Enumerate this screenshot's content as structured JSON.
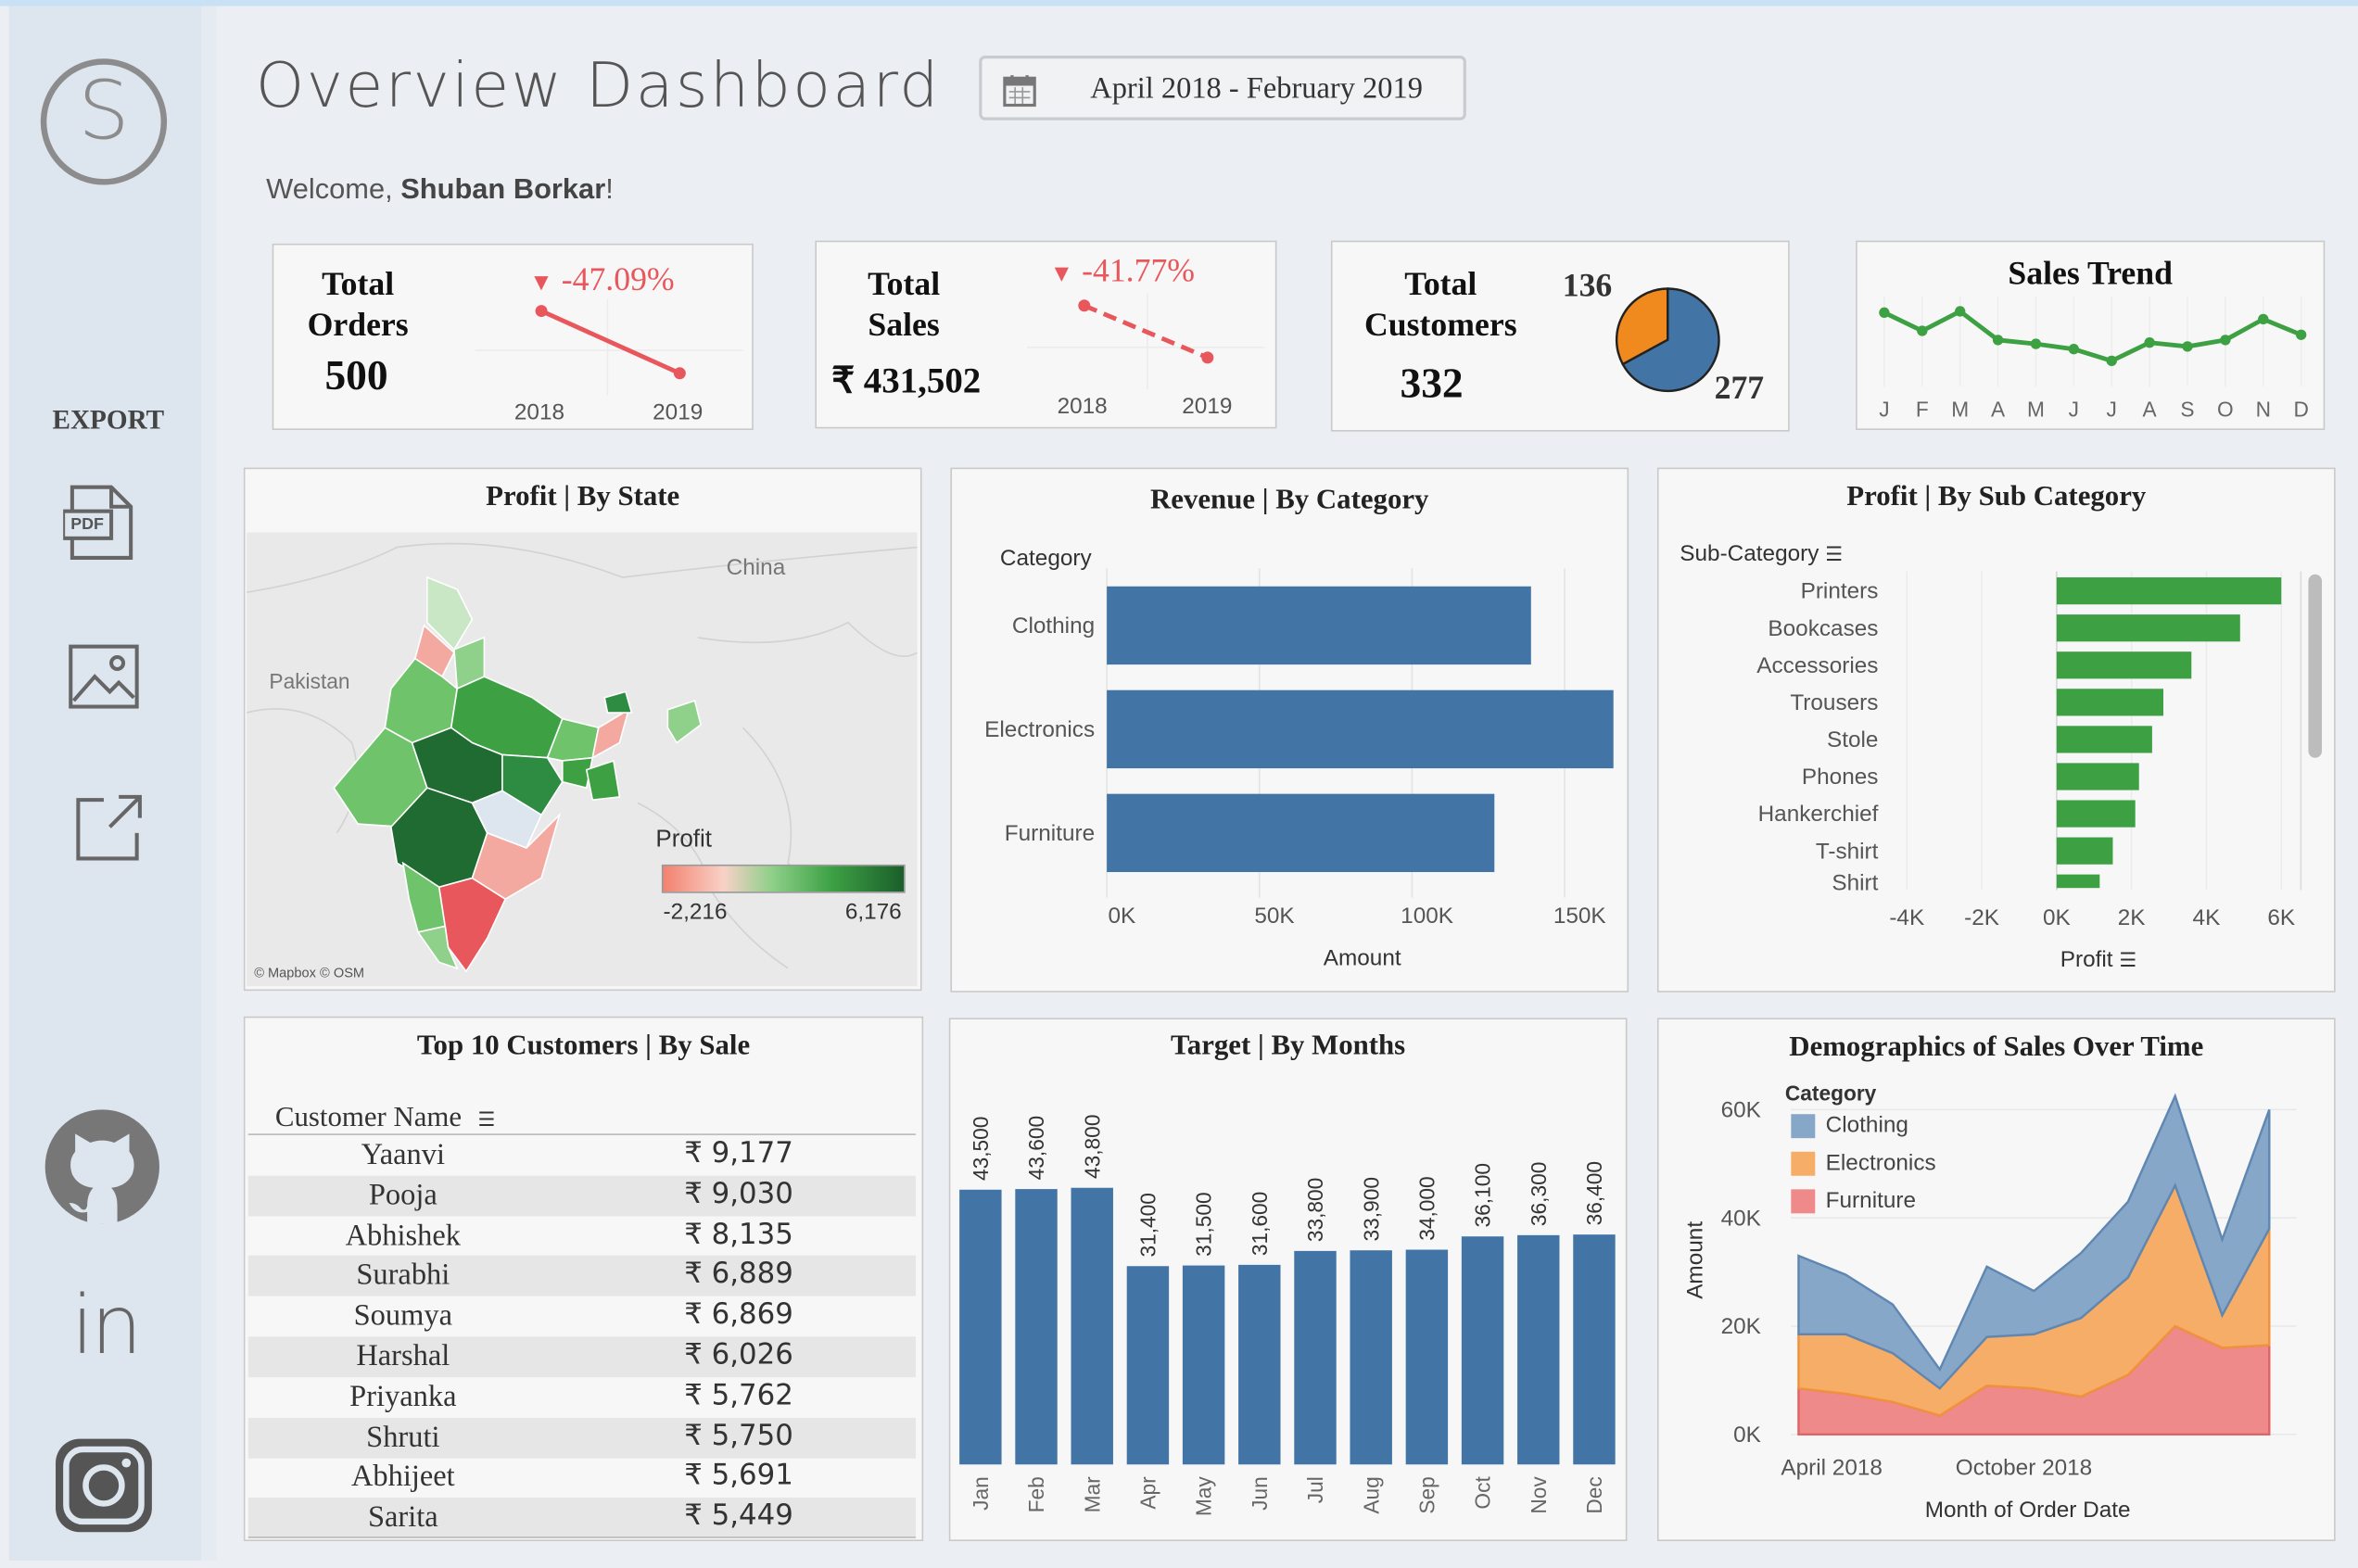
{
  "header": {
    "title": "Overview Dashboard",
    "date_range": "April 2018 - February 2019",
    "welcome_prefix": "Welcome, ",
    "user_name": "Shuban Borkar",
    "welcome_suffix": "!"
  },
  "sidebar": {
    "logo_letter": "S",
    "export_label": "EXPORT",
    "pdf_label": "PDF",
    "export_icons": [
      "pdf-icon",
      "image-icon",
      "share-icon"
    ],
    "social_icons": [
      "github-icon",
      "linkedin-icon",
      "instagram-icon"
    ],
    "linkedin_text": "in"
  },
  "kpis": {
    "orders": {
      "title_line1": "Total",
      "title_line2": "Orders",
      "value": "500",
      "delta": "-47.09%",
      "years": [
        "2018",
        "2019"
      ]
    },
    "sales": {
      "title_line1": "Total",
      "title_line2": "Sales",
      "value": "₹ 431,502",
      "delta": "-41.77%",
      "years": [
        "2018",
        "2019"
      ]
    },
    "customers": {
      "title_line1": "Total",
      "title_line2": "Customers",
      "value": "332",
      "pie_label_a": "136",
      "pie_label_b": "277"
    },
    "sales_trend": {
      "title": "Sales Trend",
      "months": [
        "J",
        "F",
        "M",
        "A",
        "M",
        "J",
        "J",
        "A",
        "S",
        "O",
        "N",
        "D"
      ]
    }
  },
  "map_panel": {
    "title": "Profit | By State",
    "labels": {
      "china": "China",
      "pakistan": "Pakistan"
    },
    "legend_title": "Profit",
    "legend_min": "-2,216",
    "legend_max": "6,176",
    "attribution": "© Mapbox © OSM"
  },
  "revenue_panel": {
    "title": "Revenue | By Category",
    "axis_header": "Category",
    "x_title": "Amount",
    "x_ticks": [
      "0K",
      "50K",
      "100K",
      "150K"
    ]
  },
  "subcat_panel": {
    "title": "Profit | By Sub Category",
    "axis_header": "Sub-Category",
    "x_title": "Profit",
    "x_ticks": [
      "-4K",
      "-2K",
      "0K",
      "2K",
      "4K",
      "6K"
    ]
  },
  "customers_panel": {
    "title": "Top 10 Customers | By Sale",
    "column_header": "Customer Name",
    "rows": [
      {
        "name": "Yaanvi",
        "value": "₹ 9,177"
      },
      {
        "name": "Pooja",
        "value": "₹ 9,030"
      },
      {
        "name": "Abhishek",
        "value": "₹ 8,135"
      },
      {
        "name": "Surabhi",
        "value": "₹ 6,889"
      },
      {
        "name": "Soumya",
        "value": "₹ 6,869"
      },
      {
        "name": "Harshal",
        "value": "₹ 6,026"
      },
      {
        "name": "Priyanka",
        "value": "₹ 5,762"
      },
      {
        "name": "Shruti",
        "value": "₹ 5,750"
      },
      {
        "name": "Abhijeet",
        "value": "₹ 5,691"
      },
      {
        "name": "Sarita",
        "value": "₹ 5,449"
      }
    ]
  },
  "target_panel": {
    "title": "Target | By Months"
  },
  "demo_panel": {
    "title": "Demographics of Sales Over Time",
    "legend_title": "Category",
    "y_title": "Amount",
    "x_title": "Month of Order Date",
    "y_ticks": [
      "60K",
      "40K",
      "20K",
      "0K"
    ],
    "x_ticks": [
      "April 2018",
      "October 2018"
    ]
  },
  "colors": {
    "accent_blue": "#4275a6",
    "bar_green": "#3da144",
    "negative_red": "#e8575c",
    "pie_orange": "#f08a1f",
    "area_clothing": "#87a7c8",
    "area_electronics": "#f6ad68",
    "area_furniture": "#ef8a8b"
  },
  "chart_data": [
    {
      "type": "line",
      "title": "Total Orders",
      "categories": [
        "2018",
        "2019"
      ],
      "series": [
        {
          "values": [
            340,
            160
          ]
        }
      ]
    },
    {
      "type": "line",
      "title": "Total Sales",
      "categories": [
        "2018",
        "2019"
      ],
      "series": [
        {
          "values": [
            296000,
            172000
          ]
        }
      ]
    },
    {
      "type": "pie",
      "title": "Total Customers",
      "labels": [
        "136",
        "277"
      ],
      "values": [
        136,
        277
      ],
      "colors": [
        "#f08a1f",
        "#4275a6"
      ]
    },
    {
      "type": "line",
      "title": "Sales Trend",
      "categories": [
        "J",
        "F",
        "M",
        "A",
        "M",
        "J",
        "J",
        "A",
        "S",
        "O",
        "N",
        "D"
      ],
      "series": [
        {
          "values": [
            52,
            38,
            53,
            31,
            28,
            24,
            15,
            29,
            26,
            31,
            47,
            35
          ]
        }
      ]
    },
    {
      "type": "bar",
      "title": "Revenue | By Category",
      "categories": [
        "Clothing",
        "Electronics",
        "Furniture"
      ],
      "values": [
        139000,
        166000,
        127000
      ],
      "xlabel": "Amount",
      "ylabel": "Category",
      "xlim": [
        0,
        170000
      ]
    },
    {
      "type": "bar",
      "title": "Profit | By Sub Category",
      "categories": [
        "Printers",
        "Bookcases",
        "Accessories",
        "Trousers",
        "Stole",
        "Phones",
        "Hankerchief",
        "T-shirt",
        "Shirt"
      ],
      "values": [
        6000,
        4900,
        3600,
        2850,
        2550,
        2200,
        2100,
        1500,
        1150
      ],
      "xlabel": "Profit",
      "ylabel": "Sub-Category",
      "xlim": [
        -4000,
        6000
      ]
    },
    {
      "type": "table",
      "title": "Top 10 Customers | By Sale",
      "columns": [
        "Customer Name",
        "Sale"
      ],
      "rows": [
        [
          "Yaanvi",
          9177
        ],
        [
          "Pooja",
          9030
        ],
        [
          "Abhishek",
          8135
        ],
        [
          "Surabhi",
          6889
        ],
        [
          "Soumya",
          6869
        ],
        [
          "Harshal",
          6026
        ],
        [
          "Priyanka",
          5762
        ],
        [
          "Shruti",
          5750
        ],
        [
          "Abhijeet",
          5691
        ],
        [
          "Sarita",
          5449
        ]
      ]
    },
    {
      "type": "bar",
      "title": "Target | By Months",
      "categories": [
        "Jan",
        "Feb",
        "Mar",
        "Apr",
        "May",
        "Jun",
        "Jul",
        "Aug",
        "Sep",
        "Oct",
        "Nov",
        "Dec"
      ],
      "values": [
        43500,
        43600,
        43800,
        31400,
        31500,
        31600,
        33800,
        33900,
        34000,
        36100,
        36300,
        36400
      ],
      "labels": [
        "43,500",
        "43,600",
        "43,800",
        "31,400",
        "31,500",
        "31,600",
        "33,800",
        "33,900",
        "34,000",
        "36,100",
        "36,300",
        "36,400"
      ],
      "ylim": [
        0,
        43800
      ]
    },
    {
      "type": "area",
      "title": "Demographics of Sales Over Time",
      "xlabel": "Month of Order Date",
      "ylabel": "Amount",
      "ylim": [
        0,
        60000
      ],
      "legend": "top-left",
      "x": [
        "2018-04",
        "2018-05",
        "2018-06",
        "2018-07",
        "2018-08",
        "2018-09",
        "2018-10",
        "2018-11",
        "2018-12",
        "2019-01",
        "2019-02"
      ],
      "series": [
        {
          "name": "Furniture",
          "values": [
            8500,
            7500,
            6000,
            3500,
            9000,
            8500,
            7000,
            11000,
            20000,
            16000,
            16500
          ]
        },
        {
          "name": "Electronics",
          "values": [
            10000,
            11000,
            9000,
            5000,
            9000,
            10000,
            14500,
            18000,
            26000,
            6000,
            21500
          ]
        },
        {
          "name": "Clothing",
          "values": [
            14500,
            11000,
            9000,
            3500,
            13000,
            8000,
            12000,
            14000,
            16500,
            14000,
            22000
          ]
        }
      ]
    }
  ]
}
